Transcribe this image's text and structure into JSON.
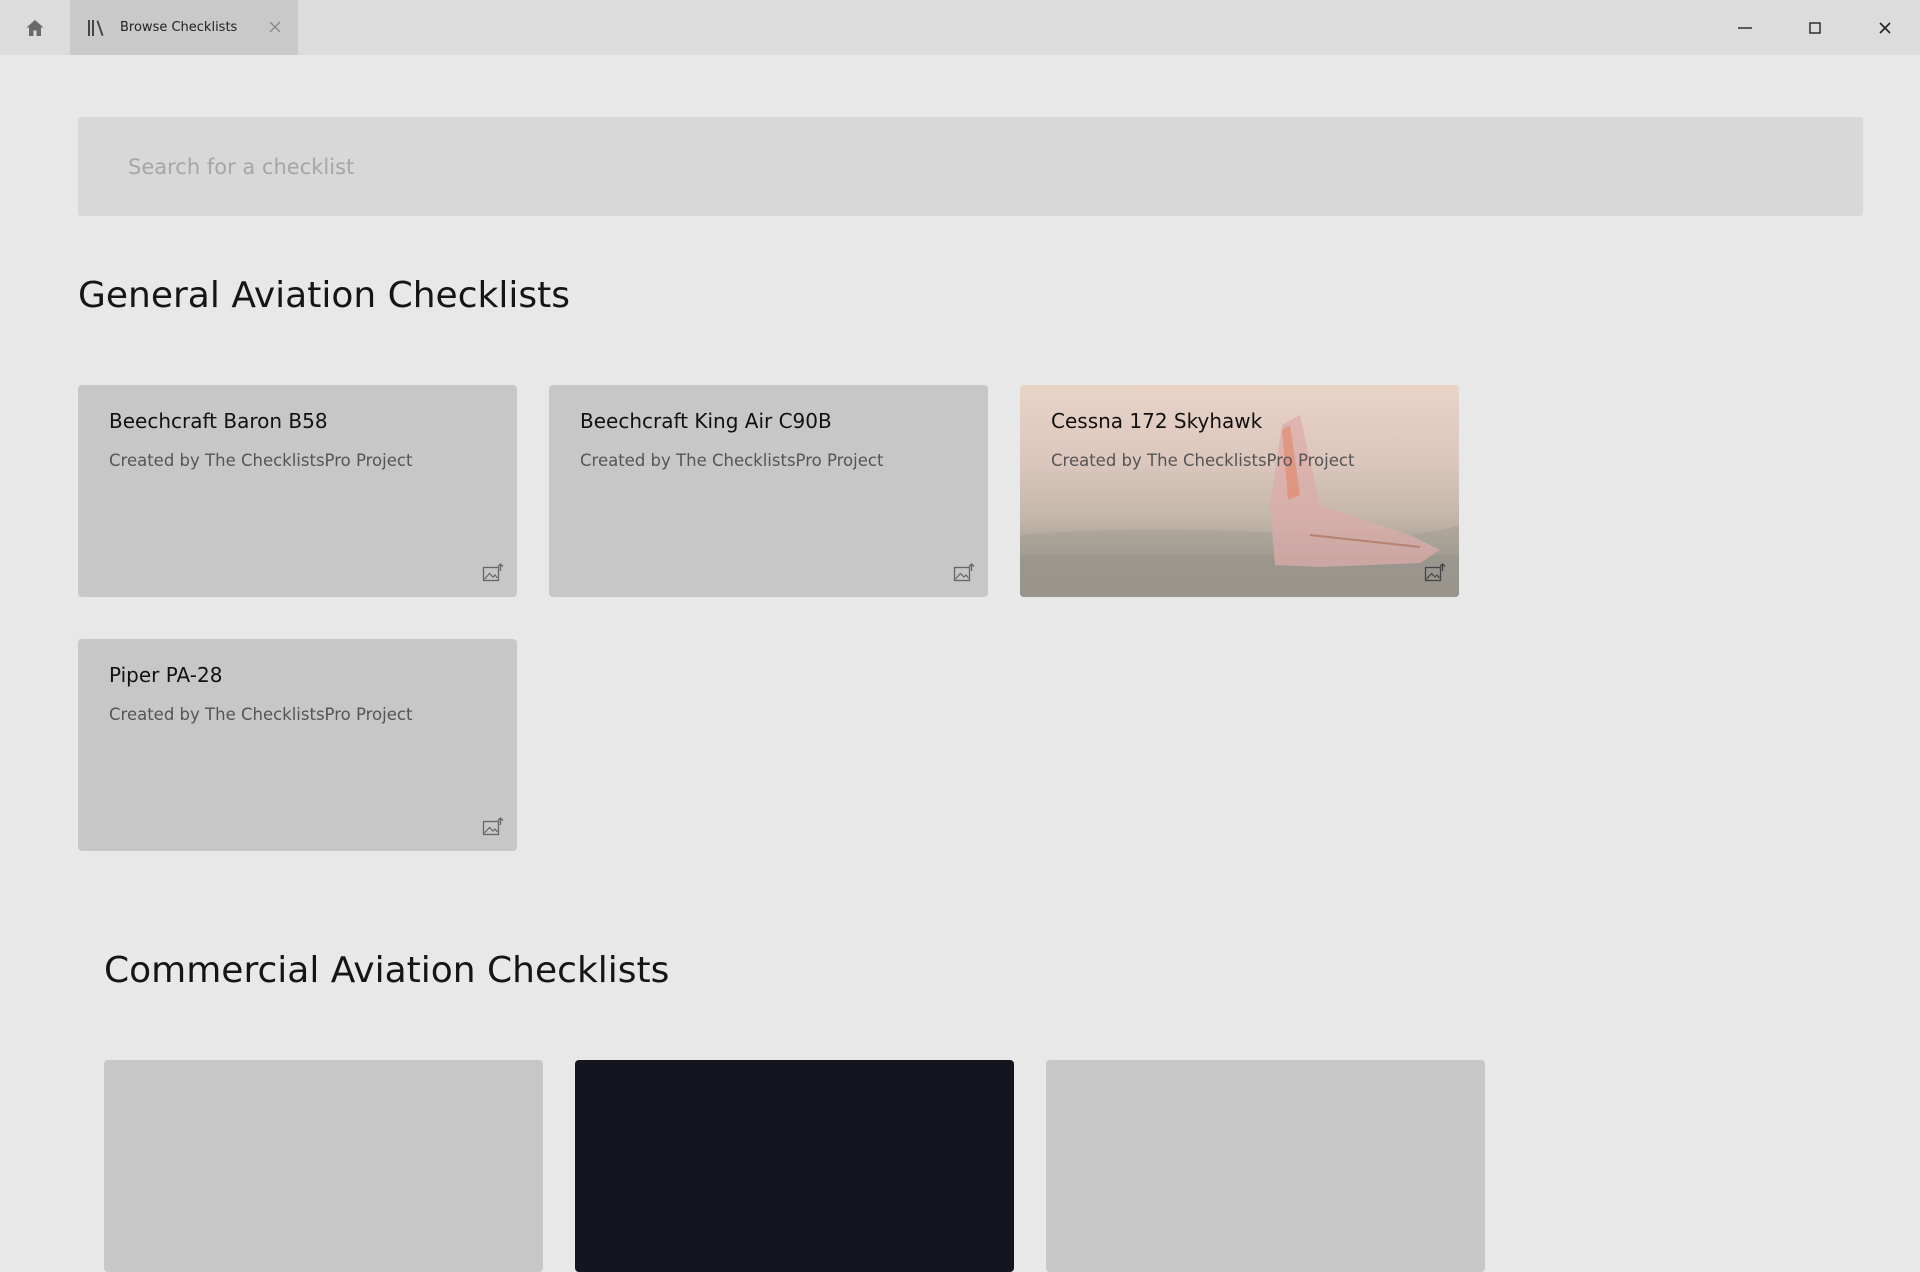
{
  "window": {
    "tab_title": "Browse Checklists"
  },
  "search": {
    "placeholder": "Search for a checklist",
    "value": ""
  },
  "sections": {
    "general": {
      "title": "General Aviation Checklists",
      "cards": [
        {
          "title": "Beechcraft Baron B58",
          "subtitle": "Created by The ChecklistsPro Project"
        },
        {
          "title": "Beechcraft King Air C90B",
          "subtitle": "Created by The ChecklistsPro Project"
        },
        {
          "title": "Cessna 172 Skyhawk",
          "subtitle": "Created by The ChecklistsPro Project"
        },
        {
          "title": "Piper PA-28",
          "subtitle": "Created by The ChecklistsPro Project"
        }
      ]
    },
    "commercial": {
      "title": "Commercial Aviation Checklists"
    }
  },
  "icons": {
    "home": "home-icon",
    "tab": "library-icon",
    "tab_close": "close-icon",
    "minimize": "minimize-icon",
    "maximize": "maximize-icon",
    "close": "close-icon",
    "change_image": "image-upload-icon"
  },
  "colors": {
    "background": "#e8e8e8",
    "titlebar": "#dcdcdc",
    "active_tab": "#c9c9c9",
    "card": "#c7c7c7",
    "search": "#d8d8d8"
  }
}
